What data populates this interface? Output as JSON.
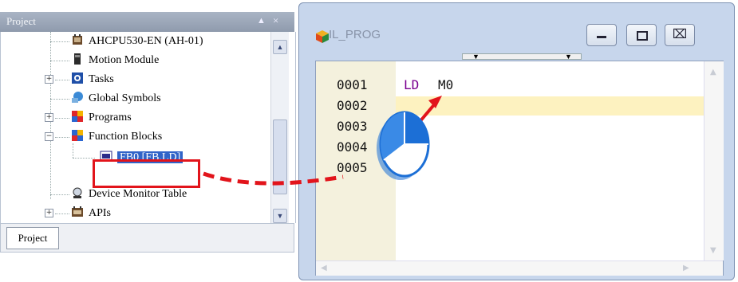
{
  "project_panel": {
    "title": "Project",
    "tab_label": "Project",
    "items": [
      {
        "label": "AHCPU530-EN (AH-01)",
        "icon": "cpu-icon"
      },
      {
        "label": "Motion Module",
        "icon": "module-icon"
      },
      {
        "label": "Tasks",
        "icon": "tasks-icon"
      },
      {
        "label": "Global Symbols",
        "icon": "symbols-icon"
      },
      {
        "label": "Programs",
        "icon": "programs-icon"
      },
      {
        "label": "Function Blocks",
        "icon": "function-blocks-icon"
      },
      {
        "label": "FB0 [FB,LD]",
        "icon": "fb-icon"
      },
      {
        "label": "Device Monitor Table",
        "icon": "monitor-icon"
      },
      {
        "label": "APIs",
        "icon": "apis-icon"
      }
    ]
  },
  "editor_window": {
    "title": "IL_PROG",
    "line_numbers": [
      "0001",
      "0002",
      "0003",
      "0004",
      "0005"
    ],
    "code": {
      "keyword": "LD",
      "operand": "M0"
    }
  },
  "colors": {
    "highlight_red": "#e2141b",
    "selection_blue": "#3164c8",
    "gutter": "#f4f1dd",
    "current_line": "#fdf2c0"
  }
}
